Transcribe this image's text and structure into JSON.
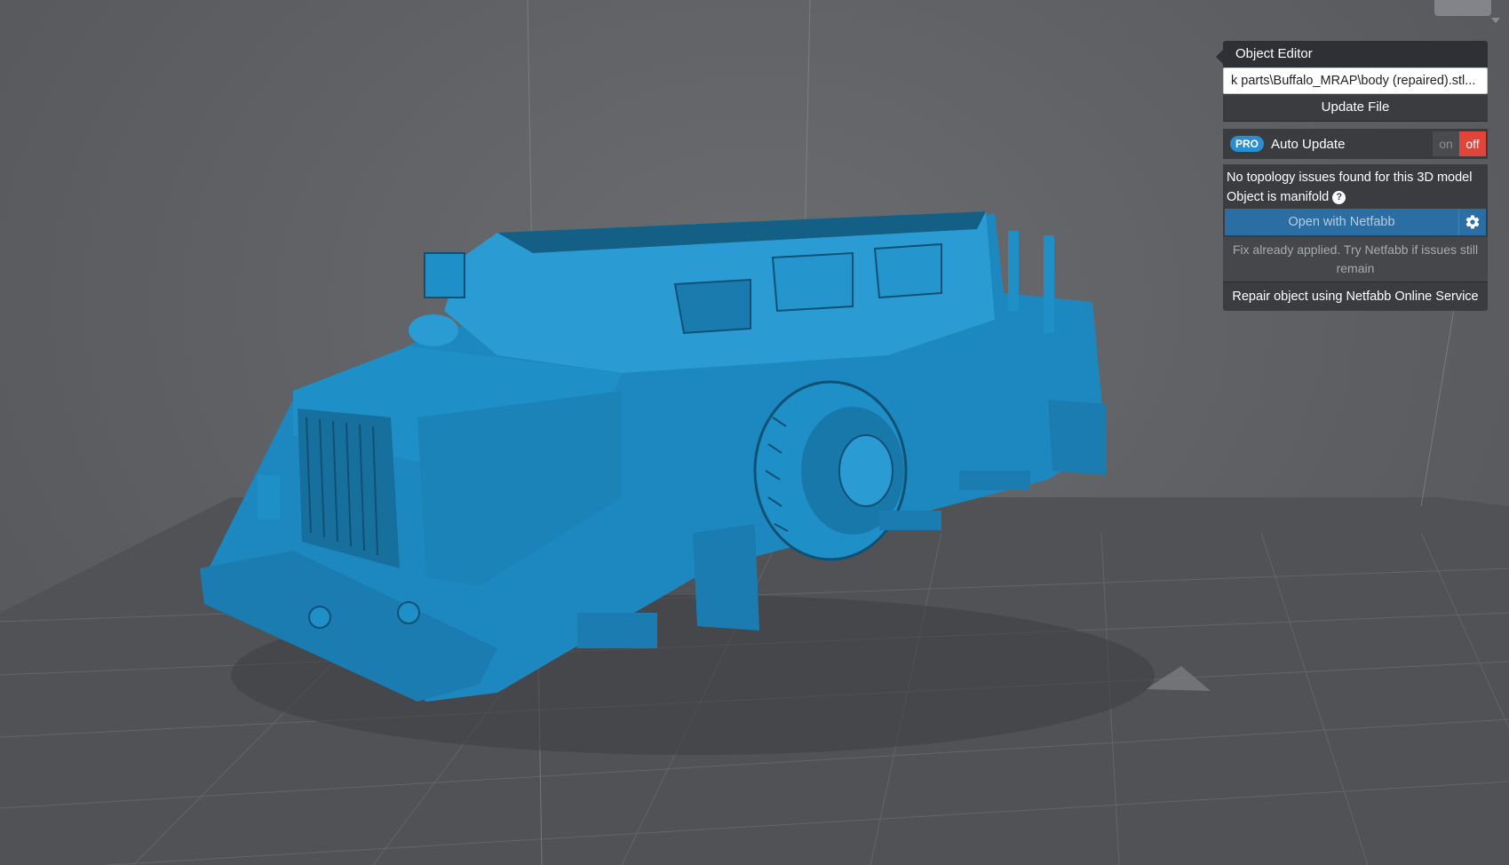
{
  "object_editor": {
    "title": "Object Editor",
    "file_path": "...k parts\\Buffalo_MRAP\\body (repaired).stl",
    "update_button": "Update File",
    "auto_update": {
      "badge": "PRO",
      "label": "Auto Update",
      "on_label": "on",
      "off_label": "off",
      "state": "off"
    },
    "status": {
      "line1": "No topology issues found for this 3D model",
      "line2": "Object is manifold",
      "help_icon": "question-icon"
    },
    "netfabb_button": "Open with Netfabb",
    "settings_icon": "gear-icon",
    "fix_note": "Fix already applied. Try Netfabb if issues still remain",
    "repair_button": "Repair object using Netfabb Online Service"
  },
  "colors": {
    "viewport_bg": "#5d5f63",
    "model": "#1f8fc7",
    "panel_bg": "#3b3c40",
    "toggle_off": "#e0453a",
    "netfabb_blue": "#2b6ea3",
    "pro_badge": "#2a8fd0"
  }
}
